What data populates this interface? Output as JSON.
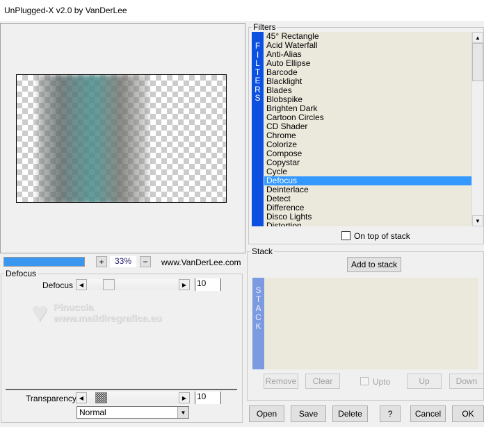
{
  "window": {
    "title": "UnPlugged-X v2.0 by VanDerLee"
  },
  "preview": {
    "zoom": "33%",
    "zoom_in_label": "+",
    "zoom_out_label": "−",
    "site": "www.VanDerLee.com",
    "progress_percent": 100,
    "progress_color": "#3a97f0"
  },
  "params": {
    "group_title": "Defocus",
    "defocus": {
      "label": "Defocus",
      "value": "10"
    },
    "transparency": {
      "label": "Transparency",
      "value": "10"
    },
    "blend_mode": "Normal"
  },
  "watermark": {
    "line1": "Pinuccia",
    "line2": "www.maildiregrafica.eu"
  },
  "filters": {
    "group_title": "Filters",
    "strip_label": "F I L T E R S",
    "selected": "Defocus",
    "accent": "#3399ff",
    "items": [
      "45° Rectangle",
      "Acid Waterfall",
      "Anti-Alias",
      "Auto Ellipse",
      "Barcode",
      "Blacklight",
      "Blades",
      "Blobspike",
      "Brighten Dark",
      "Cartoon Circles",
      "CD Shader",
      "Chrome",
      "Colorize",
      "Compose",
      "Copystar",
      "Cycle",
      "Defocus",
      "Deinterlace",
      "Detect",
      "Difference",
      "Disco Lights",
      "Distortion"
    ],
    "on_top_label": "On top of stack",
    "on_top_checked": false
  },
  "stack": {
    "group_title": "Stack",
    "add_label": "Add to stack",
    "strip_label": "S T A C K",
    "remove_label": "Remove",
    "clear_label": "Clear",
    "upto_label": "Upto",
    "up_label": "Up",
    "down_label": "Down"
  },
  "footer": {
    "open": "Open",
    "save": "Save",
    "delete": "Delete",
    "help": "?",
    "cancel": "Cancel",
    "ok": "OK"
  }
}
